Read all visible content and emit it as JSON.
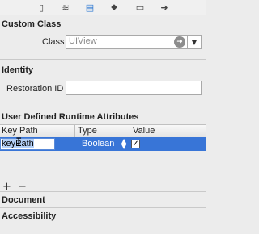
{
  "toolbar": {
    "icons": [
      "file-icon",
      "quick-help-icon",
      "identity-inspector-icon",
      "attributes-inspector-icon",
      "size-inspector-icon",
      "connections-inspector-icon"
    ]
  },
  "custom_class": {
    "title": "Custom Class",
    "class_label": "Class",
    "class_placeholder": "UIView"
  },
  "identity": {
    "title": "Identity",
    "restoration_id_label": "Restoration ID",
    "restoration_id_value": ""
  },
  "runtime_attributes": {
    "title": "User Defined Runtime Attributes",
    "columns": [
      "Key Path",
      "Type",
      "Value"
    ],
    "rows": [
      {
        "key_path": "keyPath",
        "type": "Boolean",
        "value_checked": true
      }
    ],
    "add_label": "+",
    "remove_label": "−"
  },
  "document": {
    "title": "Document"
  },
  "accessibility": {
    "title": "Accessibility"
  },
  "colors": {
    "selection": "#3875d7",
    "active_icon": "#1f6fd0"
  }
}
